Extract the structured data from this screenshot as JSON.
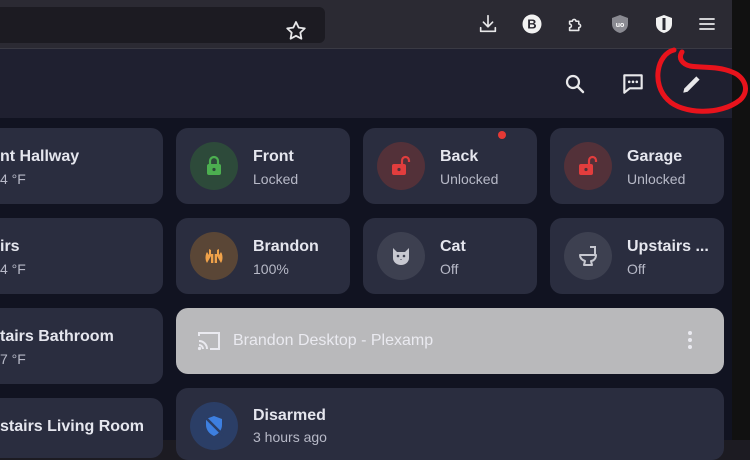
{
  "colors": {
    "annotation": "#e8131c",
    "lock_locked": "#4caf50",
    "lock_unlocked": "#e23d3d",
    "person_home": "#f0a24a"
  },
  "browser_icons": [
    "bookmark-star-icon",
    "downloads-icon",
    "bitwarden-b-icon",
    "extensions-icon",
    "ublock-icon",
    "privacy-badger-icon",
    "hamburger-menu-icon"
  ],
  "header_icons": [
    "search-icon",
    "assist-chat-icon",
    "pencil-edit-icon"
  ],
  "sensors": [
    {
      "name": "nt Hallway",
      "state": "4 °F"
    },
    {
      "name": "irs",
      "state": "4 °F"
    },
    {
      "name": "tairs Bathroom",
      "state": "7 °F"
    },
    {
      "name": "stairs Living Room",
      "state": ""
    }
  ],
  "tiles": [
    {
      "name": "Front",
      "state": "Locked",
      "icon": "lock-locked-icon"
    },
    {
      "name": "Back",
      "state": "Unlocked",
      "icon": "lock-open-icon",
      "badge": true
    },
    {
      "name": "Garage",
      "state": "Unlocked",
      "icon": "lock-open-icon"
    },
    {
      "name": "Brandon",
      "state": "100%",
      "icon": "hands-icon"
    },
    {
      "name": "Cat",
      "state": "Off",
      "icon": "cat-icon"
    },
    {
      "name": "Upstairs ...",
      "state": "Off",
      "icon": "toilet-icon"
    }
  ],
  "media": {
    "title": "Brandon Desktop - Plexamp",
    "icon": "cast-icon"
  },
  "alarm": {
    "name": "Disarmed",
    "state": "3 hours ago",
    "icon": "shield-off-icon"
  }
}
